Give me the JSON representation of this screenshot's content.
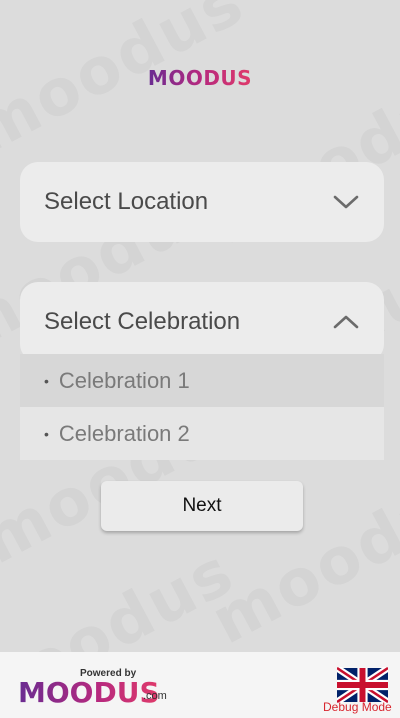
{
  "brand": {
    "top_logo": "MOODUS",
    "footer_powered_by": "Powered by",
    "footer_logo": "MOODUS",
    "footer_domain": ".com",
    "gradient": [
      "#6a2c91",
      "#b5297f",
      "#e03a6a"
    ]
  },
  "location_dropdown": {
    "label": "Select Location",
    "state": "collapsed",
    "icon": "chevron-down-icon"
  },
  "celebration_dropdown": {
    "label": "Select Celebration",
    "state": "expanded",
    "icon": "chevron-up-icon",
    "options": [
      {
        "label": "Celebration 1"
      },
      {
        "label": "Celebration 2"
      }
    ]
  },
  "actions": {
    "next_label": "Next"
  },
  "language": {
    "icon": "uk-flag-icon"
  },
  "debug": {
    "label": "Debug Mode",
    "color": "#d8262f"
  }
}
